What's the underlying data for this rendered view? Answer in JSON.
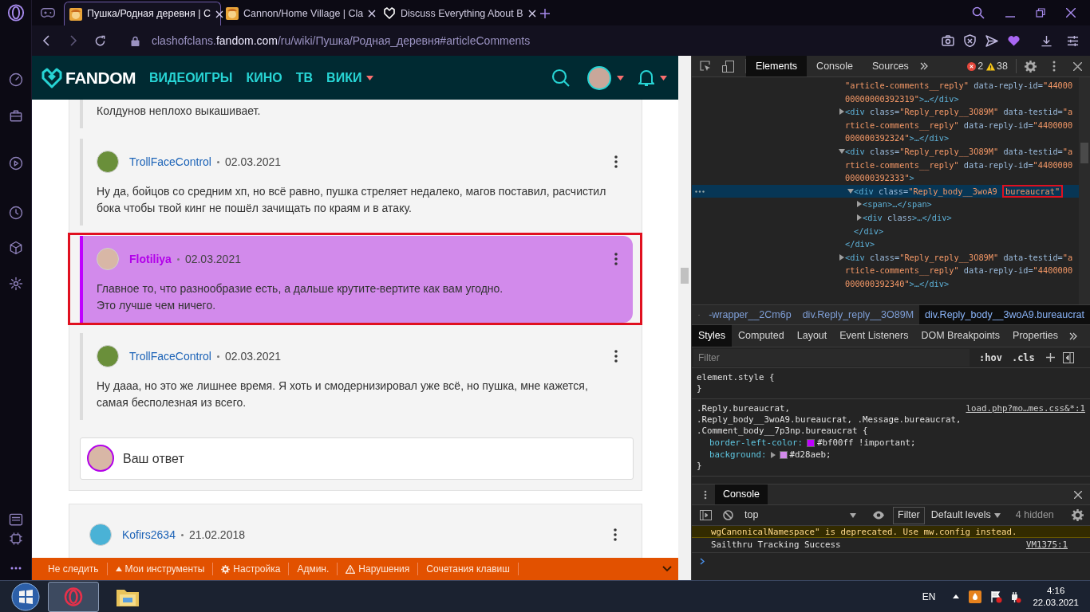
{
  "browser": {
    "tabs": [
      {
        "title": "Пушка/Родная деревня | C",
        "kind": "game",
        "selected": true
      },
      {
        "title": "Cannon/Home Village | Cla",
        "kind": "game",
        "selected": false
      },
      {
        "title": "Discuss Everything About B",
        "kind": "fandom",
        "selected": false
      }
    ],
    "address": {
      "subdomain": "clashofclans.",
      "domain": "fandom.com",
      "path": "/ru/wiki/Пушка/Родная_деревня#articleComments"
    }
  },
  "fandom_nav": {
    "logo": "FANDOM",
    "links": [
      {
        "label": "ВИДЕОИГРЫ",
        "dropdown": false
      },
      {
        "label": "КИНО",
        "dropdown": false
      },
      {
        "label": "ТВ",
        "dropdown": false
      },
      {
        "label": "ВИКИ",
        "dropdown": true
      }
    ]
  },
  "comments": {
    "replies": [
      {
        "kind": "user",
        "highlighted": false,
        "text": [
          "Колдунов неплохо выкашивает."
        ]
      },
      {
        "author": "TrollFaceControl",
        "date": "02.03.2021",
        "kind": "user",
        "highlighted": false,
        "text": [
          "Ну да, бойцов со средним хп, но всё равно, пушка стреляет недалеко, магов поставил, расчистил бока чтобы твой кинг не пошёл зачищать по краям и в атаку."
        ]
      },
      {
        "author": "Flotiliya",
        "date": "02.03.2021",
        "kind": "bureaucrat",
        "highlighted": true,
        "text": [
          "Главное то, что разнообразие есть, а дальше крутите-вертите как вам угодно.",
          "Это лучше чем ничего."
        ]
      },
      {
        "author": "TrollFaceControl",
        "date": "02.03.2021",
        "kind": "user",
        "highlighted": false,
        "text": [
          "Ну дааа, но это же лишнее время. Я хоть и смодернизировал уже всё, но пушка, мне кажется, самая бесполезная из всего."
        ]
      }
    ],
    "reply_field": {
      "placeholder": "Ваш ответ"
    },
    "next_comment": {
      "author": "Kofirs2634",
      "date": "21.02.2018"
    }
  },
  "wiki_toolbar": {
    "items": [
      {
        "label": "Не следить",
        "kind": "plain"
      },
      {
        "label": "Мои инструменты",
        "kind": "triangle"
      },
      {
        "label": "Настройка",
        "kind": "gear"
      },
      {
        "label": "Админ.",
        "kind": "plain"
      },
      {
        "label": "Нарушения",
        "kind": "warning"
      },
      {
        "label": "Сочетания клавиш",
        "kind": "plain"
      }
    ]
  },
  "devtools": {
    "tabs": [
      {
        "label": "Elements",
        "selected": true
      },
      {
        "label": "Console",
        "selected": false
      },
      {
        "label": "Sources",
        "selected": false
      }
    ],
    "errors": "2",
    "warnings": "38",
    "tree": [
      {
        "selected": false,
        "parts": [
          {
            "kind": "val",
            "t": "\"article-comments__reply\""
          },
          {
            "kind": "attr",
            "t": " data-reply-id="
          },
          {
            "kind": "val",
            "t": "\"4400000000000392319\""
          },
          {
            "kind": "tag",
            "t": ">…</div>"
          }
        ]
      },
      {
        "selected": false,
        "expanded": false,
        "parts": [
          {
            "kind": "tag",
            "t": "<div"
          },
          {
            "kind": "attr",
            "t": " class="
          },
          {
            "kind": "val",
            "t": "\"Reply_reply__3O89M\""
          },
          {
            "kind": "attr",
            "t": " data-testid="
          },
          {
            "kind": "val",
            "t": "\"article-comments__reply\""
          },
          {
            "kind": "attr",
            "t": " data-reply-id="
          },
          {
            "kind": "val",
            "t": "\"4400000000000392324\""
          },
          {
            "kind": "tag",
            "t": ">…</div>"
          }
        ]
      },
      {
        "selected": false,
        "expanded": true,
        "close": "</div>",
        "parts": [
          {
            "kind": "tag",
            "t": "<div"
          },
          {
            "kind": "attr",
            "t": " class="
          },
          {
            "kind": "val",
            "t": "\"Reply_reply__3O89M\""
          },
          {
            "kind": "attr",
            "t": " data-testid="
          },
          {
            "kind": "val",
            "t": "\"article-comments__reply\""
          },
          {
            "kind": "attr",
            "t": " data-reply-id="
          },
          {
            "kind": "val",
            "t": "\"4400000000000392333\""
          },
          {
            "kind": "tag",
            "t": ">"
          }
        ],
        "children": [
          {
            "selected": true,
            "expanded": true,
            "close": "</div>",
            "parts": [
              {
                "kind": "tag",
                "t": "<div"
              },
              {
                "kind": "attr",
                "t": " class="
              },
              {
                "kind": "val",
                "t": "\"Reply_body__3woA9 "
              },
              {
                "kind": "val",
                "t": "bureaucrat\"",
                "highlighted": true
              }
            ],
            "children": [
              {
                "selected": false,
                "expanded": false,
                "parts": [
                  {
                    "kind": "tag",
                    "t": "<span>…</span>"
                  }
                ]
              },
              {
                "selected": false,
                "expanded": false,
                "parts": [
                  {
                    "kind": "tag",
                    "t": "<div"
                  },
                  {
                    "kind": "attr",
                    "t": " class"
                  },
                  {
                    "kind": "tag",
                    "t": ">…</div>"
                  }
                ]
              }
            ]
          }
        ]
      },
      {
        "selected": false,
        "expanded": false,
        "parts": [
          {
            "kind": "tag",
            "t": "<div"
          },
          {
            "kind": "attr",
            "t": " class="
          },
          {
            "kind": "val",
            "t": "\"Reply_reply__3O89M\""
          },
          {
            "kind": "attr",
            "t": " data-testid="
          },
          {
            "kind": "val",
            "t": "\"article-comments__reply\""
          },
          {
            "kind": "attr",
            "t": " data-reply-id="
          },
          {
            "kind": "val",
            "t": "\"4400000000000392340\""
          },
          {
            "kind": "tag",
            "t": ">…</div>"
          }
        ]
      }
    ],
    "breadcrumbs": [
      {
        "label": "-wrapper__2Cm6p",
        "selected": false
      },
      {
        "label": "div.Reply_reply__3O89M",
        "selected": false
      },
      {
        "label": "div.Reply_body__3woA9.bureaucrat",
        "selected": true
      }
    ],
    "style_tabs": [
      {
        "label": "Styles",
        "selected": true
      },
      {
        "label": "Computed",
        "selected": false
      },
      {
        "label": "Layout",
        "selected": false
      },
      {
        "label": "Event Listeners",
        "selected": false
      },
      {
        "label": "DOM Breakpoints",
        "selected": false
      },
      {
        "label": "Properties",
        "selected": false
      }
    ],
    "styles_filter": {
      "placeholder": "Filter"
    },
    "style_buttons": [
      ":hov",
      ".cls"
    ],
    "rules": [
      {
        "selector_lines": [
          "element.style {"
        ],
        "close": "}"
      },
      {
        "selector_lines": [
          ".Reply.bureaucrat,",
          ".Reply_body__3woA9.bureaucrat, .Message.bureaucrat,",
          ".Comment_body__7p3np.bureaucrat {"
        ],
        "source": "load.php?mo…mes.css&*:1",
        "declarations": [
          {
            "property": "border-left-color:",
            "value": "#bf00ff !important;",
            "color": "#bf00ff",
            "expandable": false
          },
          {
            "property": "background:",
            "value": "#d28aeb;",
            "color": "#d28aeb",
            "expandable": true
          }
        ],
        "close": "}"
      }
    ],
    "console": {
      "title": "Console",
      "context": "top",
      "filter": "Filter",
      "levels": "Default levels",
      "hidden": "4 hidden",
      "messages": [
        {
          "kind": "warning",
          "text": "wgCanonicalNamespace\" is deprecated. Use mw.config instead."
        },
        {
          "kind": "log",
          "text": "Sailthru Tracking Success",
          "source": "VM1375:1"
        }
      ]
    }
  },
  "taskbar": {
    "language": "EN",
    "time": "4:16",
    "date": "22.03.2021"
  }
}
